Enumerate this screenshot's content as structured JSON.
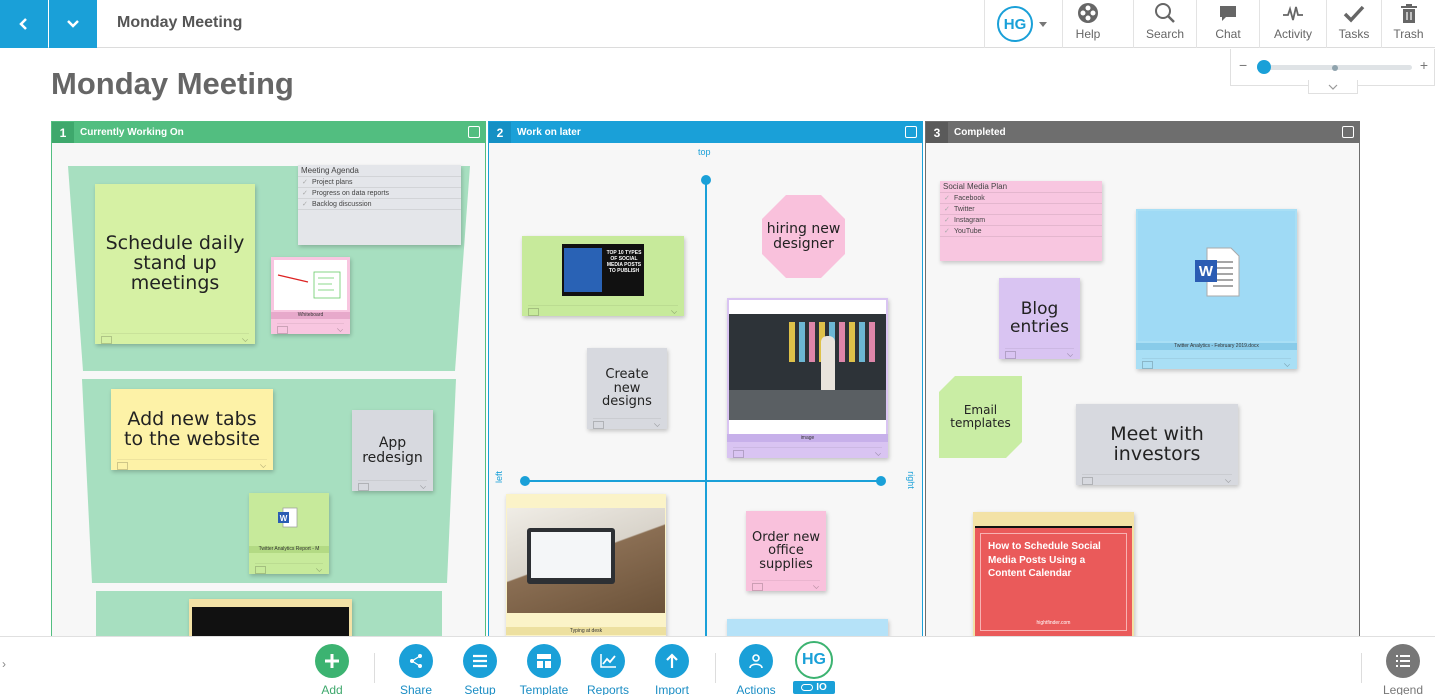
{
  "app": {
    "title": "Monday Meeting",
    "heading": "Monday Meeting",
    "avatar_initials": "HG",
    "accent_color": "#1aa0d8"
  },
  "toolbar": {
    "help": "Help",
    "search": "Search",
    "chat": "Chat",
    "activity": "Activity",
    "tasks": "Tasks",
    "trash": "Trash"
  },
  "columns": [
    {
      "number": "1",
      "name": "Currently Working On",
      "color": "#52be80"
    },
    {
      "number": "2",
      "name": "Work on later",
      "color": "#1aa0d8"
    },
    {
      "number": "3",
      "name": "Completed",
      "color": "#6e6e6e"
    }
  ],
  "col1": {
    "note_standup": "Schedule daily stand up meetings",
    "note_tabs": "Add new tabs to the website",
    "note_app": "App redesign",
    "agenda": {
      "title": "Meeting Agenda",
      "items": [
        "Project plans",
        "Progress on data reports",
        "Backlog discussion"
      ]
    },
    "whiteboard_caption": "Whiteboard",
    "doc_caption": "Twitter Analytics Report - M"
  },
  "col2": {
    "axis_top": "top",
    "axis_left": "left",
    "axis_right": "right",
    "note_designer": "hiring new designer",
    "note_designs": "Create new designs",
    "note_supplies": "Order new office supplies",
    "image_caption": "image",
    "typing_caption": "Typing at desk",
    "social_banner": "TOP 10 TYPES OF SOCIAL MEDIA POSTS TO PUBLISH"
  },
  "col3": {
    "social_plan": {
      "title": "Social Media Plan",
      "items": [
        "Facebook",
        "Twitter",
        "Instagram",
        "YouTube"
      ]
    },
    "note_blog": "Blog entries",
    "note_email": "Email templates",
    "note_investors": "Meet with investors",
    "word_caption": "Twitter Analytics - February 2019.docx",
    "schedule_banner": "How to Schedule Social Media Posts Using a Content Calendar",
    "schedule_url": "hightfinder.com"
  },
  "bottom": {
    "add": "Add",
    "share": "Share",
    "setup": "Setup",
    "template": "Template",
    "reports": "Reports",
    "import": "Import",
    "actions": "Actions",
    "avatar": "HG",
    "io_label": "IO",
    "legend": "Legend"
  }
}
